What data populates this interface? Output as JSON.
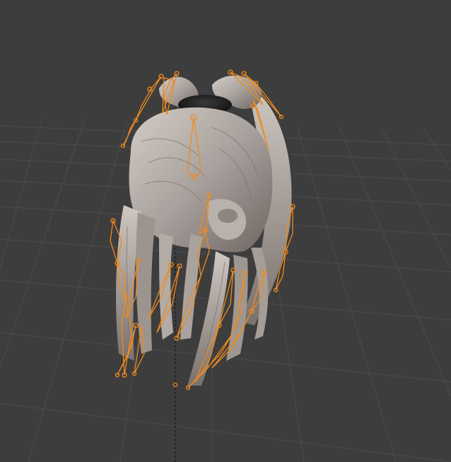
{
  "viewport": {
    "background": "#3d3d3d",
    "grid_color": "#4a4a4a",
    "axis_color": "#1f1f1f"
  },
  "mesh": {
    "name": "hair",
    "base_color": "#a8a19d",
    "shadow_color": "#5a524f",
    "highlight_color": "#d8d2cc",
    "tie_color": "#1c1c1c"
  },
  "armature": {
    "selected_color": "#f08a1e",
    "bone_count": 48
  }
}
